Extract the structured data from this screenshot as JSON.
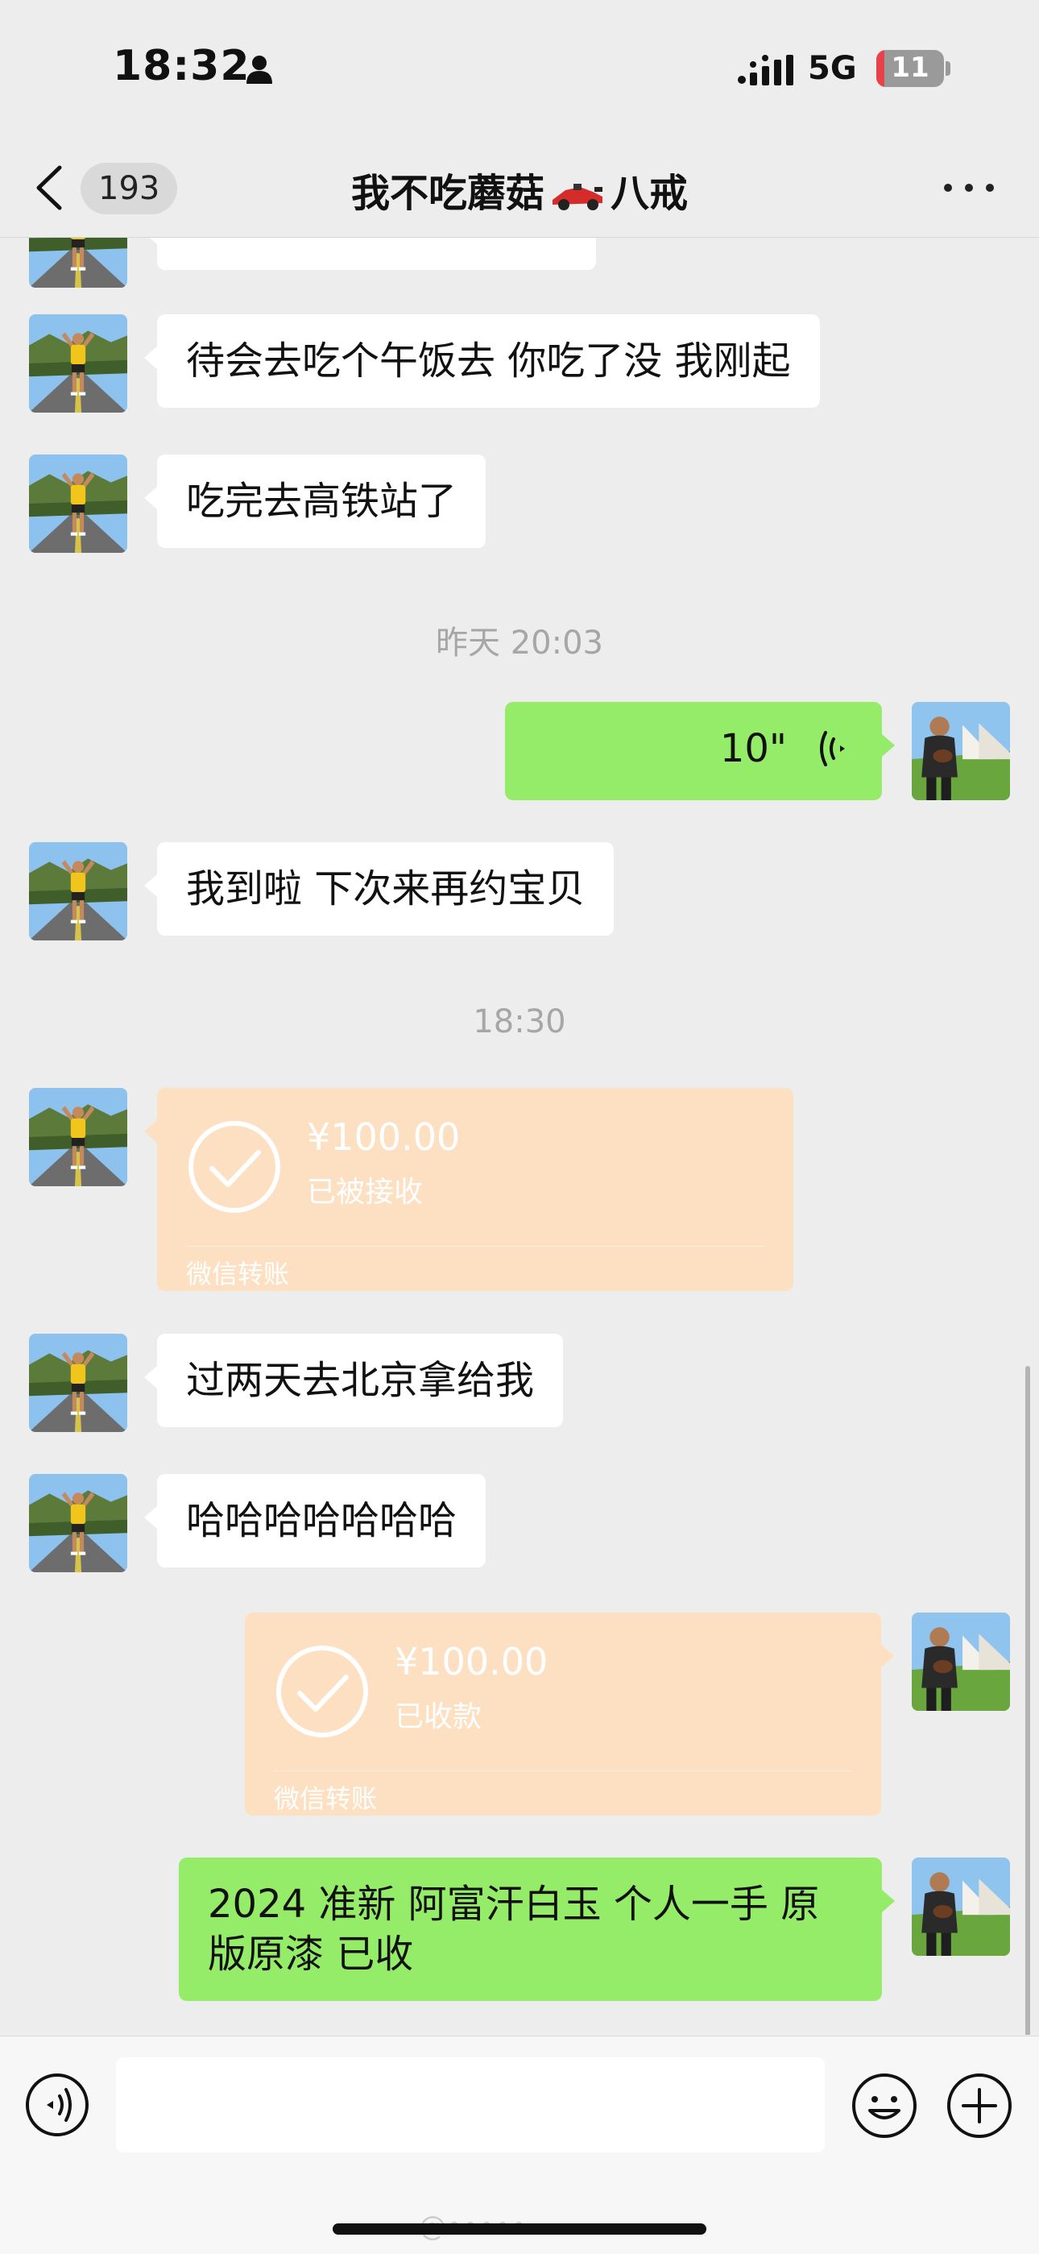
{
  "status_bar": {
    "time": "18:32",
    "network": "5G",
    "battery": "11"
  },
  "nav": {
    "unread_count": "193",
    "title_part1": "我不吃蘑菇",
    "title_part2": "八戒",
    "back_icon": "chevron-left-icon",
    "more_icon": "more-dots-icon"
  },
  "messages": [
    {
      "type": "text",
      "from": "them",
      "text": "待会去吃个午饭去 你吃了没 我刚起"
    },
    {
      "type": "text",
      "from": "them",
      "text": "吃完去高铁站了"
    },
    {
      "type": "timestamp",
      "text": "昨天 20:03"
    },
    {
      "type": "voice",
      "from": "me",
      "duration": "10\""
    },
    {
      "type": "text",
      "from": "them",
      "text": "我到啦 下次来再约宝贝"
    },
    {
      "type": "timestamp",
      "text": "18:30"
    },
    {
      "type": "transfer",
      "from": "them",
      "amount": "¥100.00",
      "status": "已被接收",
      "brand": "微信转账"
    },
    {
      "type": "text",
      "from": "them",
      "text": "过两天去北京拿给我"
    },
    {
      "type": "text",
      "from": "them",
      "text": "哈哈哈哈哈哈哈"
    },
    {
      "type": "transfer",
      "from": "me",
      "amount": "¥100.00",
      "status": "已收款",
      "brand": "微信转账"
    },
    {
      "type": "text",
      "from": "me",
      "text": "2024 准新 阿富汗白玉 个人一手 原版原漆 已收"
    }
  ],
  "input_bar": {
    "placeholder": "",
    "icons": [
      "voice-input-icon",
      "emoji-icon",
      "plus-icon"
    ]
  },
  "watermark": "@•••••",
  "colors": {
    "background": "#ededed",
    "incoming_bubble": "#ffffff",
    "outgoing_bubble": "#95ec69",
    "transfer_card": "#fde0c2",
    "timestamp": "#a6a6a6"
  }
}
